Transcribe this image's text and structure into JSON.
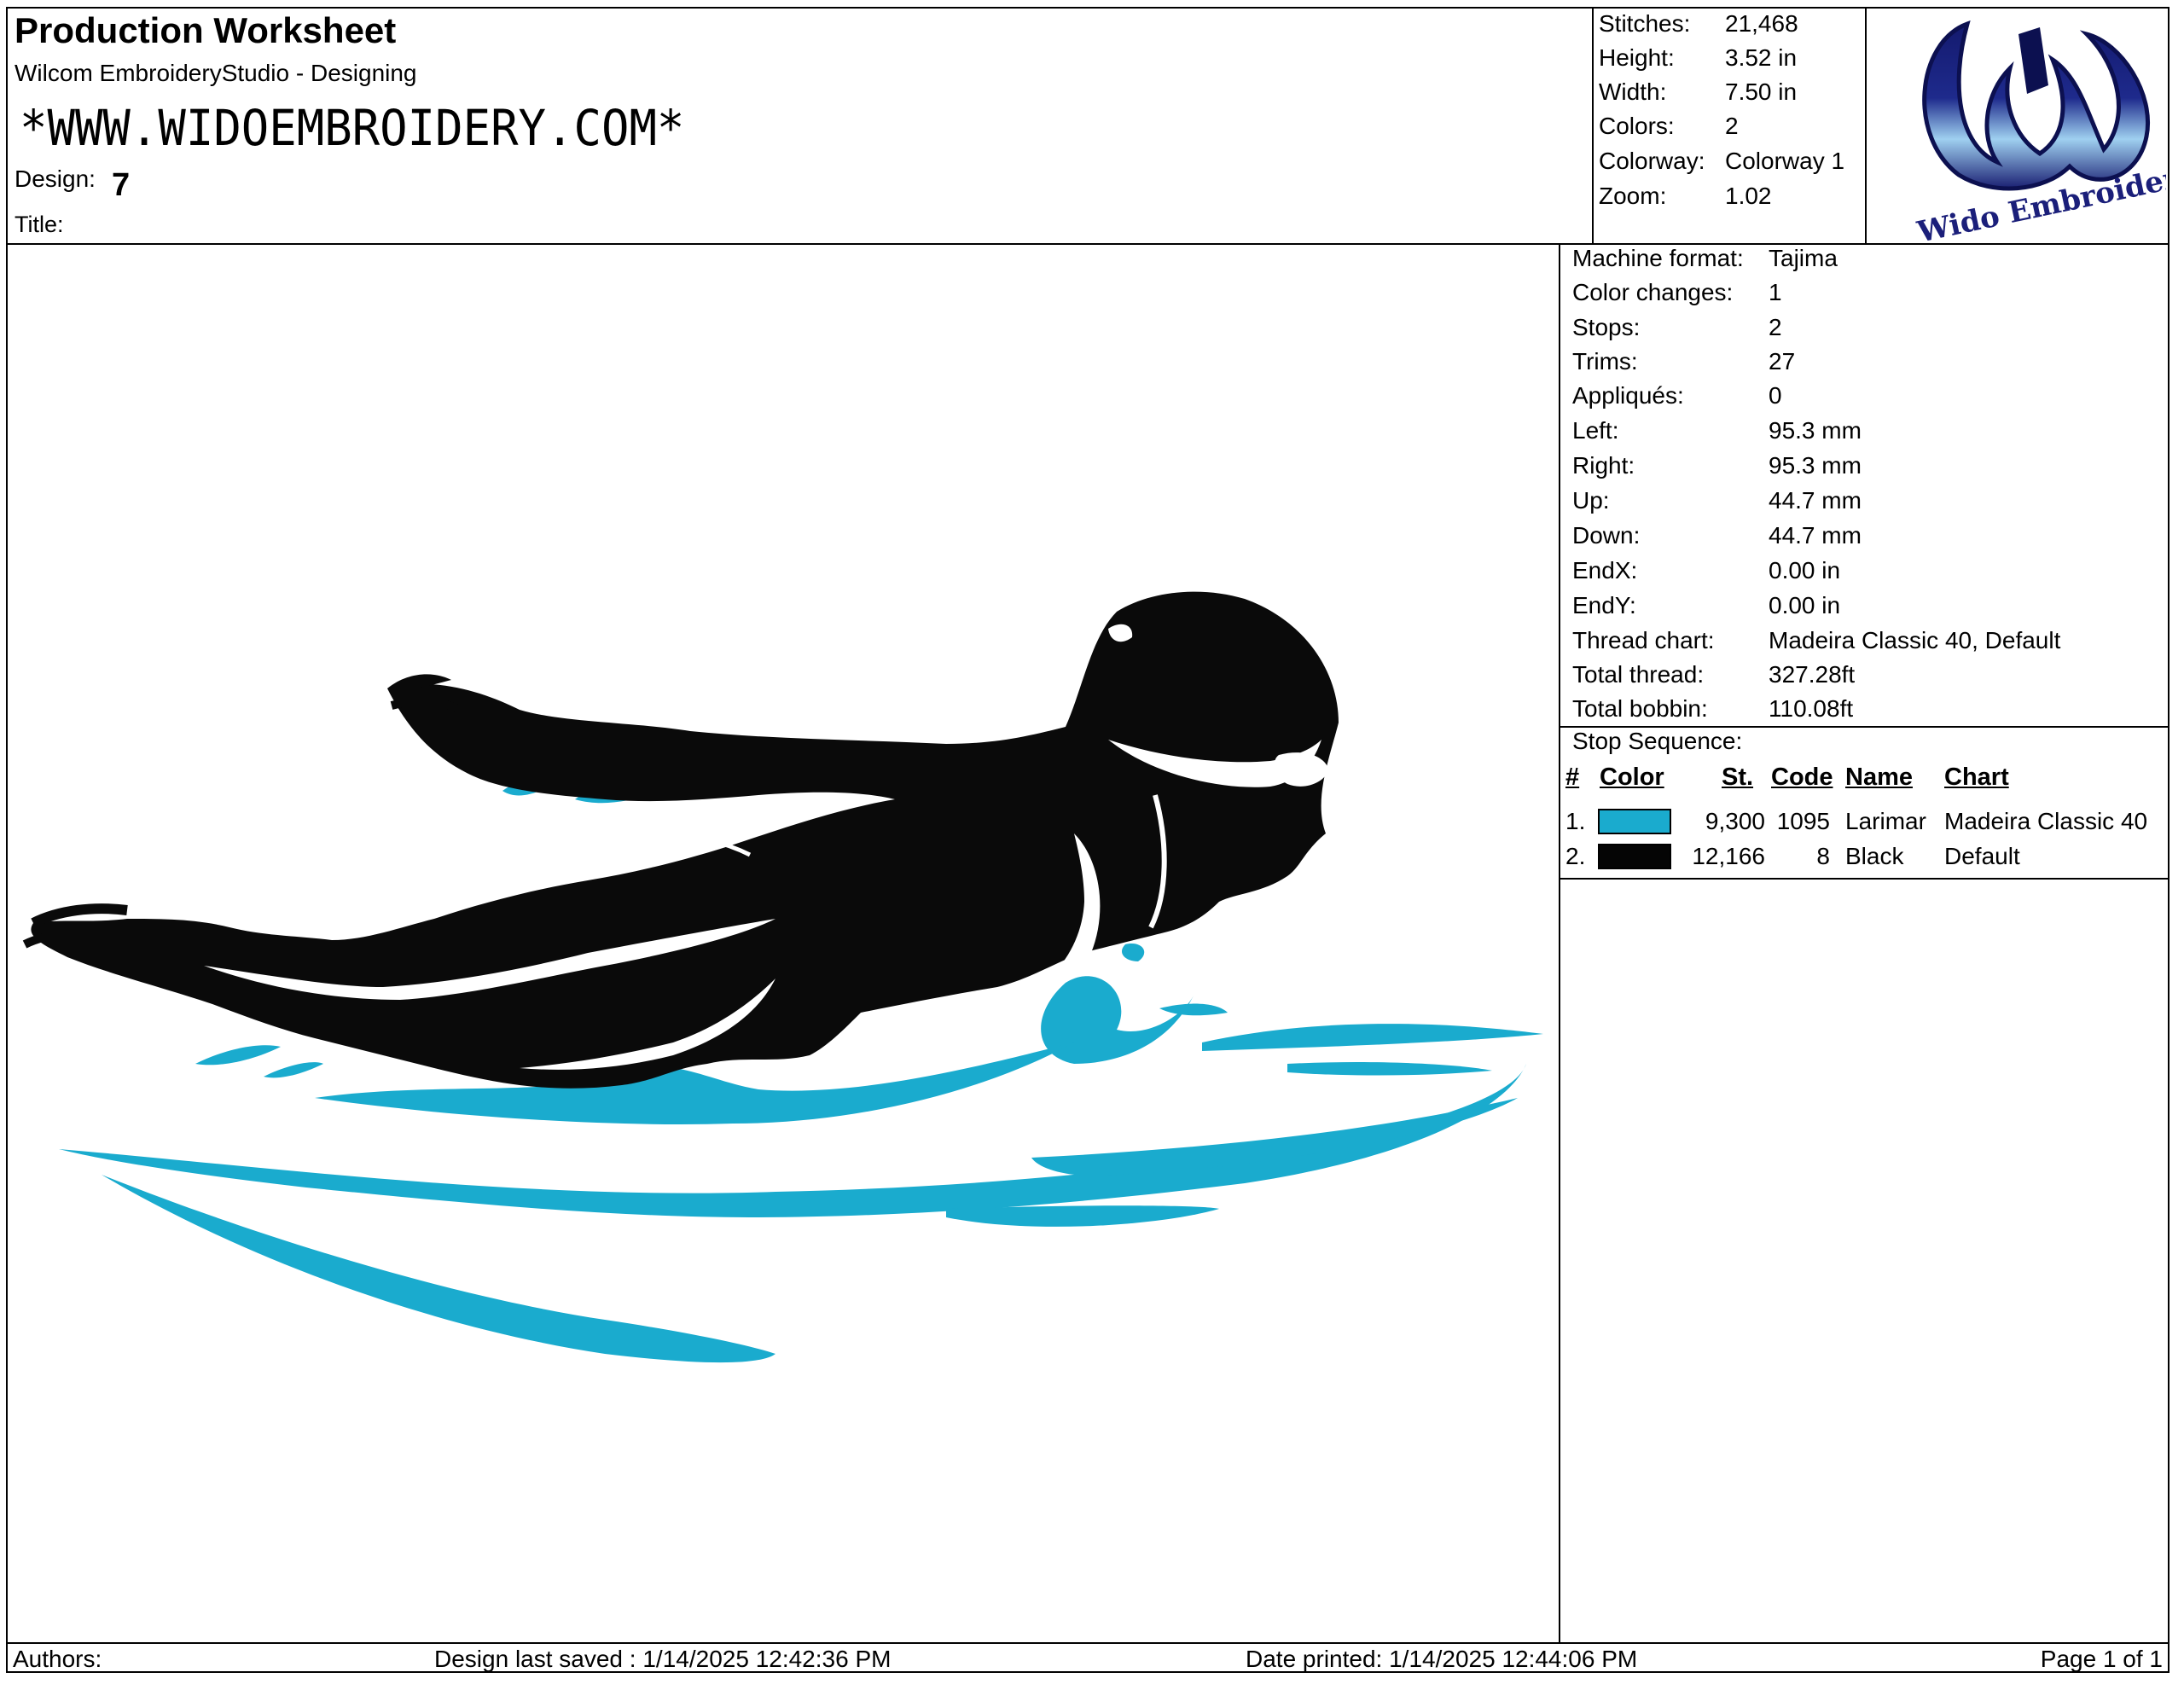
{
  "header": {
    "title": "Production Worksheet",
    "software": "Wilcom EmbroideryStudio - Designing",
    "website": "*WWW.WIDOEMBROIDERY.COM*",
    "design_label": "Design:",
    "design_value": "7",
    "title_label": "Title:"
  },
  "stats": [
    {
      "label": "Stitches:",
      "value": "21,468"
    },
    {
      "label": "Height:",
      "value": "3.52 in"
    },
    {
      "label": "Width:",
      "value": "7.50 in"
    },
    {
      "label": "Colors:",
      "value": "2"
    },
    {
      "label": "Colorway:",
      "value": "Colorway 1"
    },
    {
      "label": "Zoom:",
      "value": "1.02"
    }
  ],
  "logo": {
    "text": "Wido Embroidery",
    "color_dark": "#1b1f7a",
    "color_light": "#7ab8e6"
  },
  "info": [
    {
      "label": "Machine format:",
      "value": "Tajima"
    },
    {
      "label": "Color changes:",
      "value": "1"
    },
    {
      "label": "Stops:",
      "value": "2"
    },
    {
      "label": "Trims:",
      "value": "27"
    },
    {
      "label": "Appliqués:",
      "value": "0"
    },
    {
      "label": "Left:",
      "value": "95.3 mm"
    },
    {
      "label": "Right:",
      "value": "95.3 mm"
    },
    {
      "label": "Up:",
      "value": "44.7 mm"
    },
    {
      "label": "Down:",
      "value": "44.7 mm"
    },
    {
      "label": "EndX:",
      "value": "0.00 in"
    },
    {
      "label": "EndY:",
      "value": "0.00 in"
    },
    {
      "label": "Thread chart:",
      "value": "Madeira Classic 40, Default"
    },
    {
      "label": "Total thread:",
      "value": "327.28ft"
    },
    {
      "label": "Total bobbin:",
      "value": "110.08ft"
    }
  ],
  "stop_sequence": {
    "title": "Stop Sequence:",
    "headers": {
      "num": "#",
      "color": "Color",
      "st": "St.",
      "code": "Code",
      "name": "Name",
      "chart": "Chart"
    },
    "rows": [
      {
        "num": "1.",
        "swatch": "#1aabce",
        "st": "9,300",
        "code": "1095",
        "name": "Larimar",
        "chart": "Madeira Classic 40"
      },
      {
        "num": "2.",
        "swatch": "#050505",
        "st": "12,166",
        "code": "8",
        "name": "Black",
        "chart": "Default"
      }
    ]
  },
  "artwork": {
    "water_color": "#1aabce",
    "figure_color": "#0a0a0a"
  },
  "footer": {
    "authors": "Authors:",
    "last_saved": "Design last saved : 1/14/2025 12:42:36 PM",
    "date_printed": "Date printed: 1/14/2025 12:44:06 PM",
    "page": "Page 1 of 1"
  }
}
